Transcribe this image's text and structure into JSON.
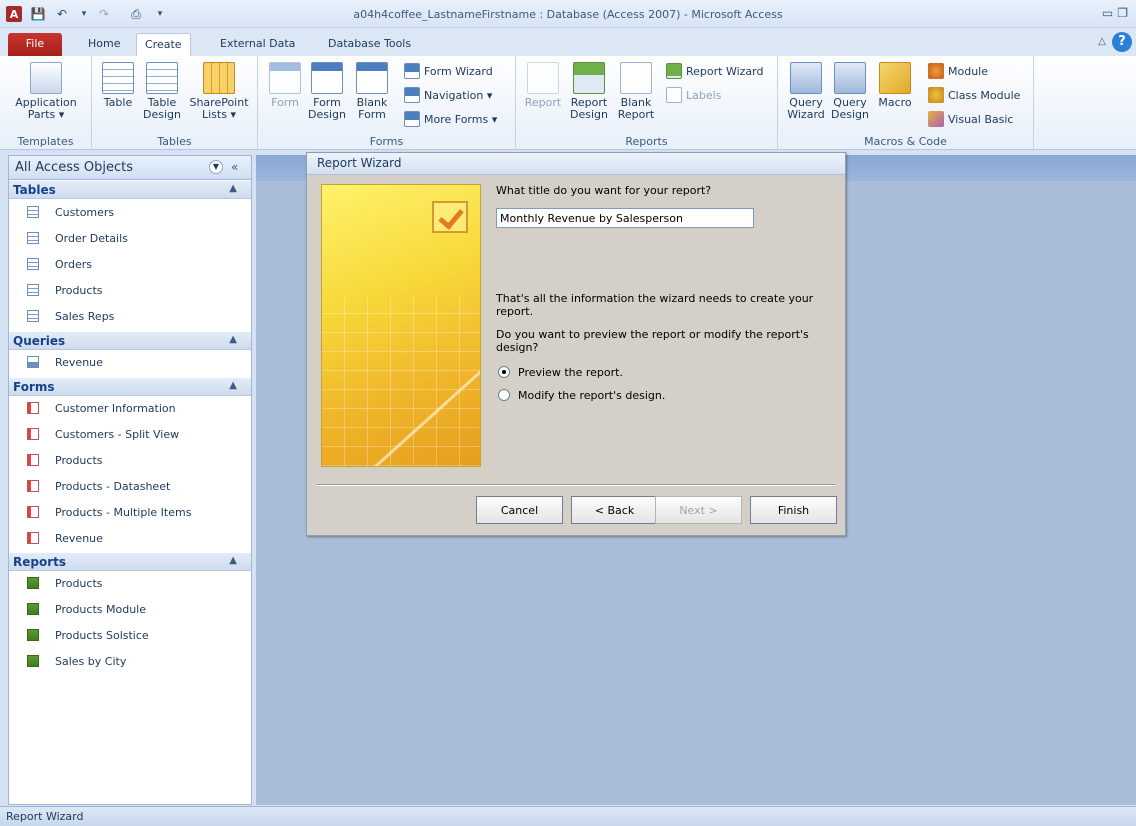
{
  "window": {
    "title": "a04h4coffee_LastnameFirstname : Database (Access 2007) - Microsoft Access",
    "app_icon": "A"
  },
  "quick_access": {
    "save_icon": "save-icon",
    "undo_icon": "undo-icon",
    "redo_icon": "redo-icon",
    "print_icon": "print-icon",
    "customize_icon": "customize-icon"
  },
  "tabs": [
    "File",
    "Home",
    "Create",
    "External Data",
    "Database Tools"
  ],
  "active_tab": "Create",
  "ribbon": {
    "templates": {
      "label": "Templates",
      "application_parts": "Application Parts ▾"
    },
    "tables": {
      "label": "Tables",
      "table": "Table",
      "table_design": "Table Design",
      "sharepoint_lists": "SharePoint Lists ▾"
    },
    "forms": {
      "label": "Forms",
      "form": "Form",
      "form_design": "Form Design",
      "blank_form": "Blank Form",
      "form_wizard": "Form Wizard",
      "navigation": "Navigation ▾",
      "more_forms": "More Forms ▾"
    },
    "reports": {
      "label": "Reports",
      "report": "Report",
      "report_design": "Report Design",
      "blank_report": "Blank Report",
      "report_wizard": "Report Wizard",
      "labels": "Labels"
    },
    "macros": {
      "label": "Macros & Code",
      "query_wizard": "Query Wizard",
      "query_design": "Query Design",
      "macro": "Macro",
      "module": "Module",
      "class_module": "Class Module",
      "visual_basic": "Visual Basic"
    }
  },
  "nav": {
    "title": "All Access Objects",
    "sections": {
      "tables": {
        "label": "Tables",
        "items": [
          "Customers",
          "Order Details",
          "Orders",
          "Products",
          "Sales Reps"
        ]
      },
      "queries": {
        "label": "Queries",
        "items": [
          "Revenue"
        ]
      },
      "forms": {
        "label": "Forms",
        "items": [
          "Customer Information",
          "Customers - Split View",
          "Products",
          "Products - Datasheet",
          "Products - Multiple Items",
          "Revenue"
        ]
      },
      "reports": {
        "label": "Reports",
        "items": [
          "Products",
          "Products Module",
          "Products Solstice",
          "Sales by City"
        ]
      }
    }
  },
  "wizard": {
    "title": "Report Wizard",
    "question": "What title do you want for your report?",
    "report_title_value": "Monthly Revenue by Salesperson",
    "info": "That's all the information the wizard needs to create your report.",
    "question2": "Do you want to preview the report or modify the report's design?",
    "option_preview": "Preview the report.",
    "option_modify": "Modify the report's design.",
    "selected_option": "preview",
    "cancel": "Cancel",
    "back": "< Back",
    "next": "Next >",
    "finish": "Finish"
  },
  "status": {
    "text": "Report Wizard"
  }
}
